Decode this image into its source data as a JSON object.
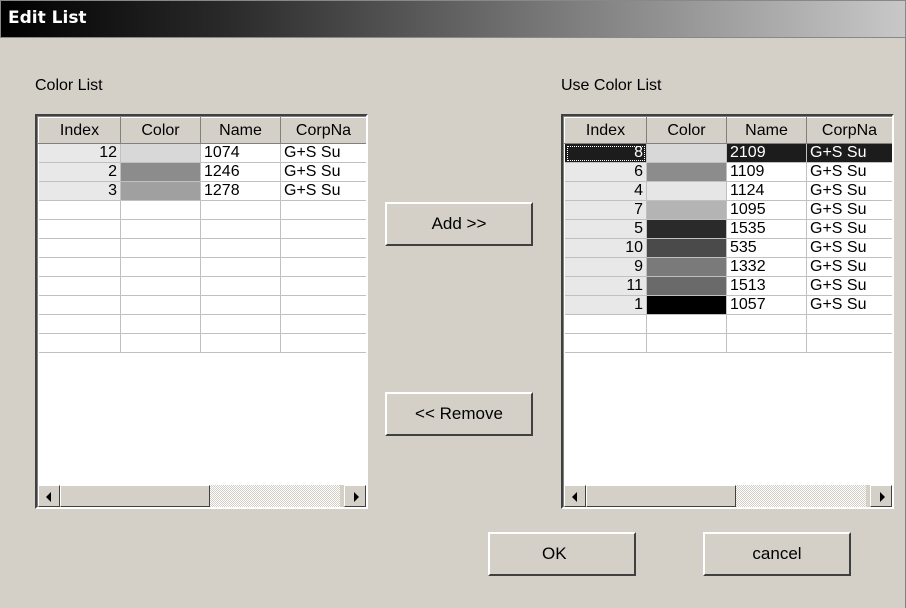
{
  "window": {
    "title": "Edit List"
  },
  "left_panel": {
    "label": "Color List",
    "columns": [
      "Index",
      "Color",
      "Name",
      "CorpNa"
    ],
    "rows": [
      {
        "index": "12",
        "color": "#d8d8d8",
        "name": "1074",
        "corp": "G+S Su"
      },
      {
        "index": "2",
        "color": "#8c8c8c",
        "name": "1246",
        "corp": "G+S Su"
      },
      {
        "index": "3",
        "color": "#a0a0a0",
        "name": "1278",
        "corp": "G+S Su"
      }
    ],
    "empty_rows": 8
  },
  "right_panel": {
    "label": "Use Color List",
    "columns": [
      "Index",
      "Color",
      "Name",
      "CorpNa"
    ],
    "rows": [
      {
        "index": "8",
        "color": "#d8d8d8",
        "name": "2109",
        "corp": "G+S Su",
        "selected": true
      },
      {
        "index": "6",
        "color": "#8c8c8c",
        "name": "1109",
        "corp": "G+S Su"
      },
      {
        "index": "4",
        "color": "#e6e6e6",
        "name": "1124",
        "corp": "G+S Su"
      },
      {
        "index": "7",
        "color": "#b4b4b4",
        "name": "1095",
        "corp": "G+S Su"
      },
      {
        "index": "5",
        "color": "#2a2a2a",
        "name": "1535",
        "corp": "G+S Su"
      },
      {
        "index": "10",
        "color": "#4a4a4a",
        "name": "535",
        "corp": "G+S Su"
      },
      {
        "index": "9",
        "color": "#7a7a7a",
        "name": "1332",
        "corp": "G+S Su"
      },
      {
        "index": "11",
        "color": "#6a6a6a",
        "name": "1513",
        "corp": "G+S Su"
      },
      {
        "index": "1",
        "color": "#000000",
        "name": "1057",
        "corp": "G+S Su"
      }
    ],
    "empty_rows": 2
  },
  "buttons": {
    "add": "Add >>",
    "remove": "<< Remove",
    "ok": "OK",
    "cancel": "cancel"
  }
}
